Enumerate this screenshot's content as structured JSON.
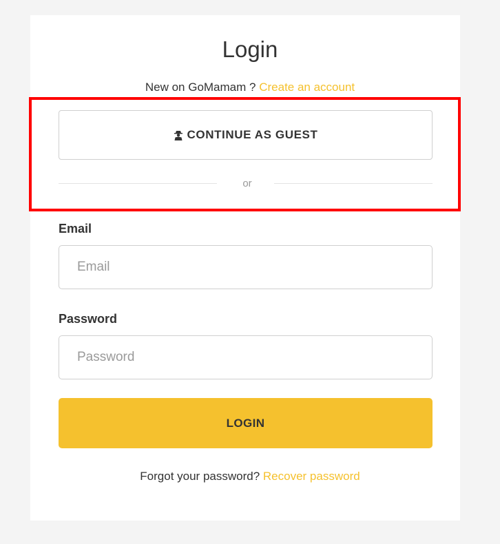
{
  "login": {
    "title": "Login",
    "signup_prompt": "New on GoMamam ?",
    "signup_link": "Create an account",
    "guest_button": "CONTINUE AS GUEST",
    "divider": "or",
    "email_label": "Email",
    "email_placeholder": "Email",
    "password_label": "Password",
    "password_placeholder": "Password",
    "login_button": "LOGIN",
    "forgot_prompt": "Forgot your password?",
    "recover_link": "Recover password"
  },
  "icons": {
    "guest": "user-secret-icon"
  },
  "colors": {
    "accent": "#f5c12e",
    "highlight": "#ff0000",
    "text": "#333333",
    "border": "#cfcfcf",
    "page_background": "#f4f4f4",
    "card_background": "#ffffff"
  }
}
